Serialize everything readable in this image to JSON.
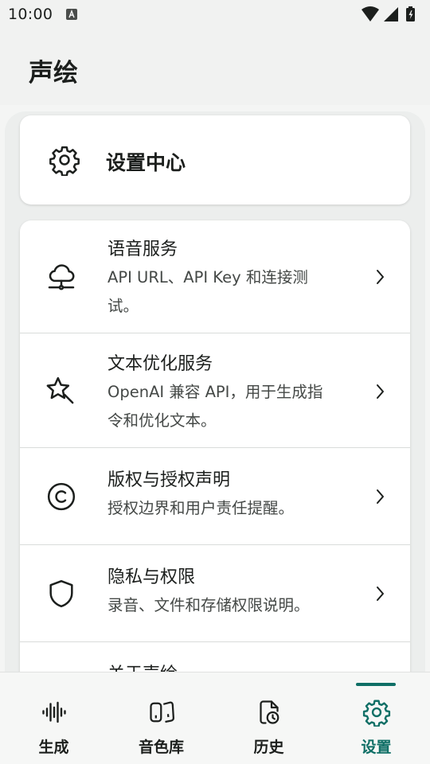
{
  "status_bar": {
    "time": "10:00",
    "icons": [
      "app-notification-icon",
      "wifi-icon",
      "signal-icon",
      "battery-icon"
    ]
  },
  "app_bar": {
    "title": "声绘"
  },
  "header_card": {
    "icon": "gear-icon",
    "title": "设置中心"
  },
  "settings": {
    "items": [
      {
        "icon": "cloud-network-icon",
        "title": "语音服务",
        "desc_line1": "API URL、API Key 和连接测",
        "desc_line2": "试。"
      },
      {
        "icon": "sparkle-icon",
        "title": "文本优化服务",
        "desc_line1": "OpenAI 兼容 API，用于生成指",
        "desc_line2": "令和优化文本。"
      },
      {
        "icon": "copyright-icon",
        "title": "版权与授权声明",
        "desc_line1": "授权边界和用户责任提醒。"
      },
      {
        "icon": "shield-icon",
        "title": "隐私与权限",
        "desc_line1": "录音、文件和存储权限说明。"
      },
      {
        "icon": "info-icon",
        "title": "关于声绘"
      }
    ]
  },
  "bottom_nav": {
    "items": [
      {
        "icon": "waveform-icon",
        "label": "生成"
      },
      {
        "icon": "voice-library-icon",
        "label": "音色库"
      },
      {
        "icon": "history-file-icon",
        "label": "历史"
      },
      {
        "icon": "gear-icon",
        "label": "设置"
      }
    ],
    "active_index": 3
  },
  "colors": {
    "accent": "#0f6f66",
    "background": "#f1f2f1",
    "card": "#ffffff",
    "text_primary": "#1c1f1d",
    "text_secondary": "#444846",
    "divider": "#d9dcda"
  }
}
